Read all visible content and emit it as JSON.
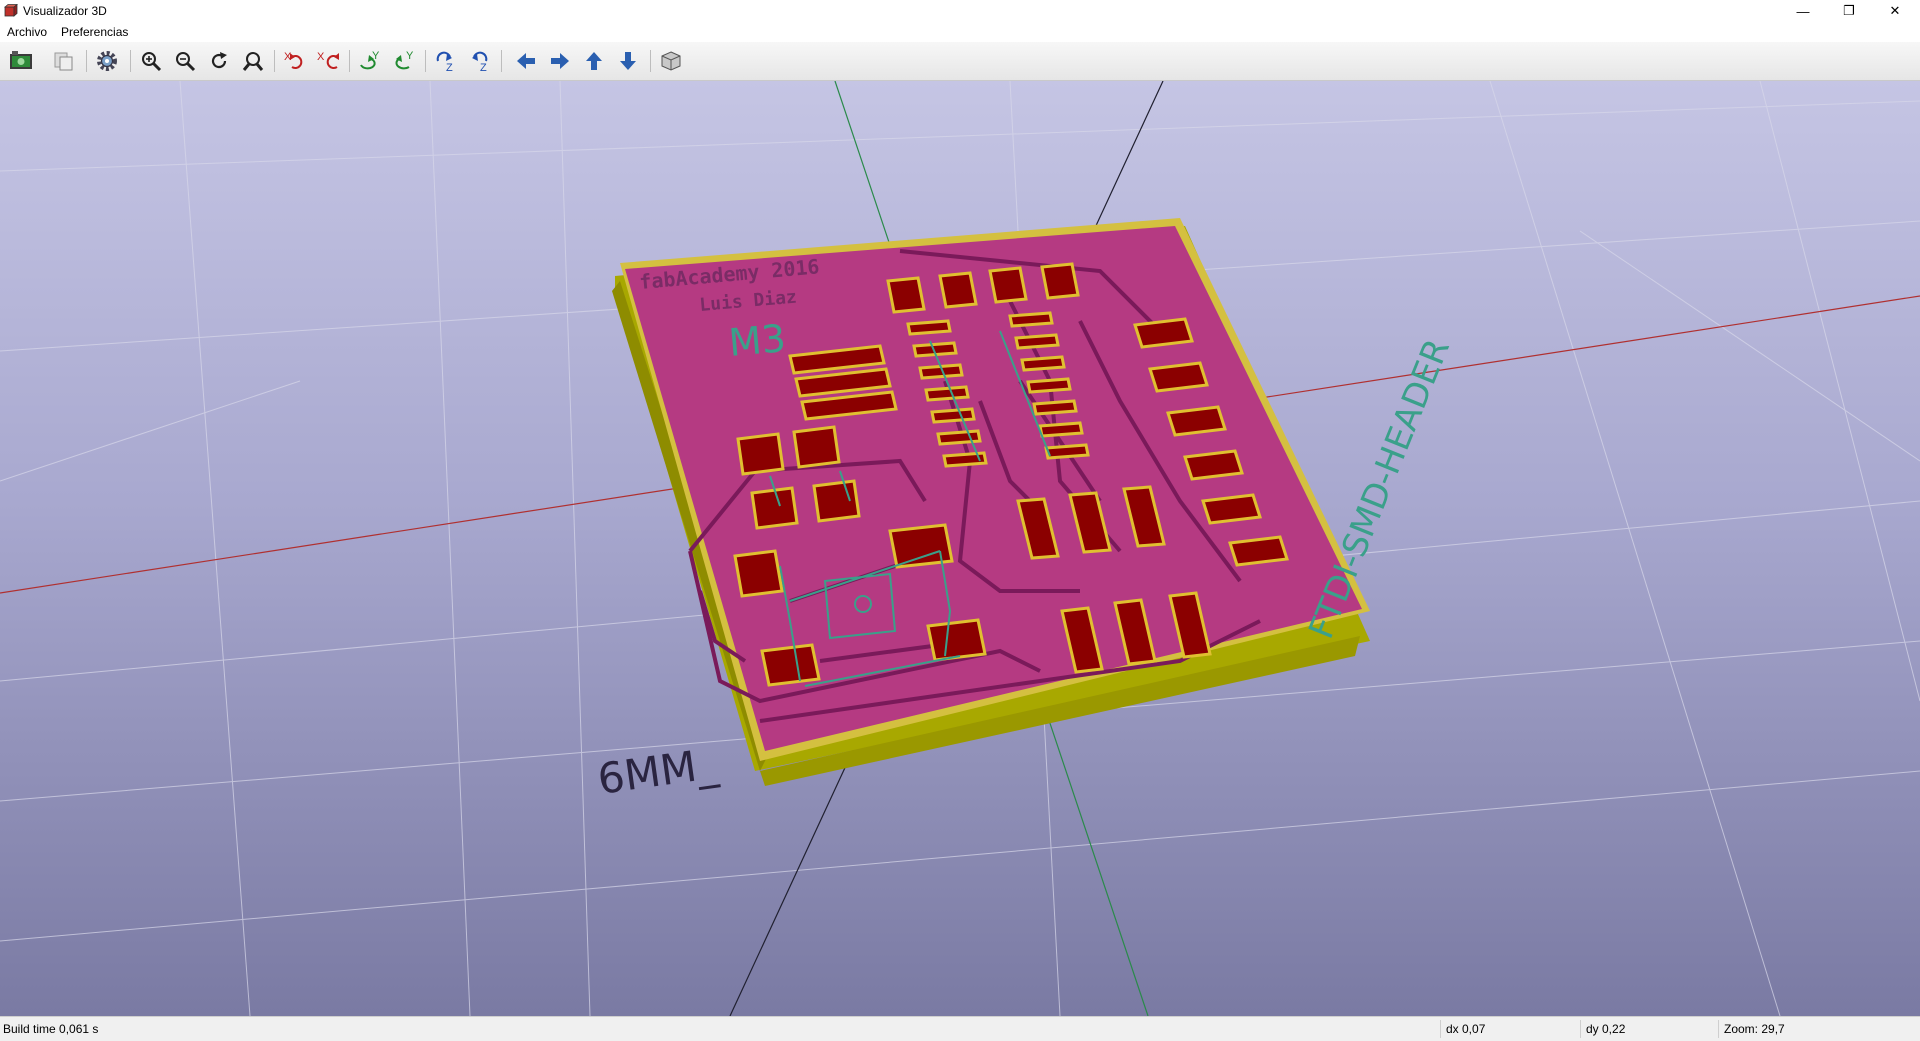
{
  "window": {
    "title": "Visualizador 3D",
    "controls": {
      "minimize": "—",
      "restore": "❐",
      "close": "✕"
    }
  },
  "menu": {
    "items": [
      {
        "label": "Archivo"
      },
      {
        "label": "Preferencias"
      }
    ]
  },
  "toolbar": {
    "buttons": [
      {
        "icon": "export-image-icon"
      },
      {
        "icon": "copy-clipboard-icon"
      },
      {
        "icon": "settings-gear-icon"
      },
      {
        "icon": "zoom-in-icon"
      },
      {
        "icon": "zoom-out-icon"
      },
      {
        "icon": "redraw-icon"
      },
      {
        "icon": "zoom-fit-icon"
      },
      {
        "icon": "rotate-x-cw-icon"
      },
      {
        "icon": "rotate-x-ccw-icon"
      },
      {
        "icon": "rotate-y-cw-icon"
      },
      {
        "icon": "rotate-y-ccw-icon"
      },
      {
        "icon": "rotate-z-cw-icon"
      },
      {
        "icon": "rotate-z-ccw-icon"
      },
      {
        "icon": "move-left-icon"
      },
      {
        "icon": "move-right-icon"
      },
      {
        "icon": "move-up-icon"
      },
      {
        "icon": "move-down-icon"
      },
      {
        "icon": "ortho-cube-icon"
      }
    ]
  },
  "board": {
    "silk_line1": "fabAcademy 2016",
    "silk_line2": "Luis Diaz",
    "silk_m3": "M3",
    "silk_ftdi": "FTDI-SMD-HEADER",
    "silk_6mm": "6MM_",
    "colors": {
      "board_edge": "#a8a800",
      "solder_mask": "#b53a82",
      "copper_pad": "#8b0000",
      "pad_outline": "#e0c030",
      "trace": "#7a1a5a",
      "silk_teal": "#3aa08a",
      "axis_x": "#b03030",
      "axis_y": "#2a8a4a",
      "axis_z": "#202030"
    }
  },
  "status": {
    "build_time": "Build time 0,061 s",
    "dx": "dx 0,07",
    "dy": "dy 0,22",
    "zoom": "Zoom: 29,7"
  }
}
